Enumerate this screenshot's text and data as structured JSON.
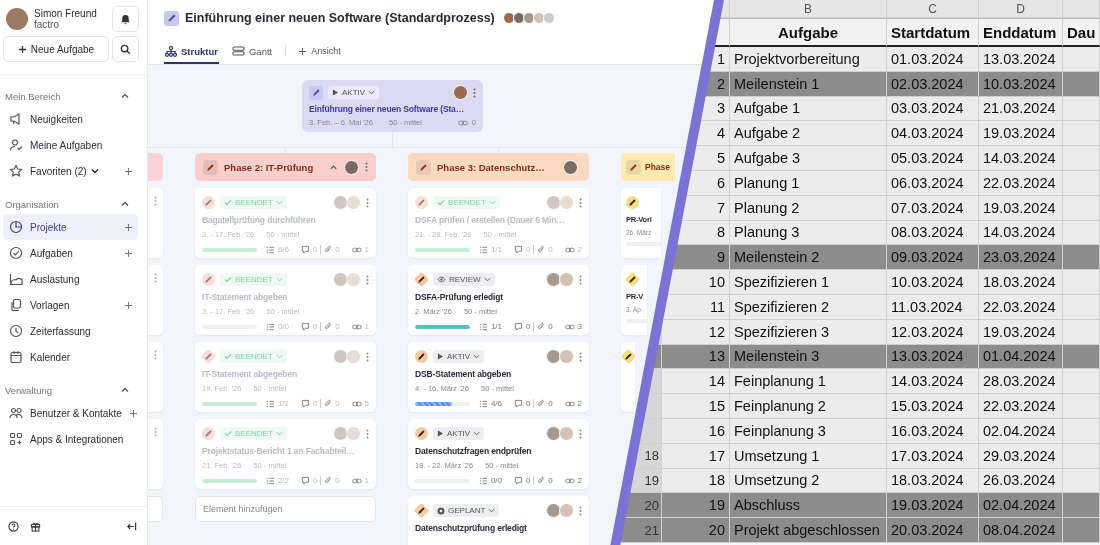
{
  "sidebar": {
    "user": {
      "name": "Simon Freund",
      "company": "factro"
    },
    "new_task_button": "Neue Aufgabe",
    "sections": [
      {
        "title": "Mein Bereich",
        "expanded": true,
        "items": [
          {
            "label": "Neuigkeiten",
            "selected": false,
            "addable": false,
            "submenu": false
          },
          {
            "label": "Meine Aufgaben",
            "selected": false,
            "addable": false,
            "submenu": false
          },
          {
            "label": "Favoriten (2)",
            "selected": false,
            "addable": true,
            "submenu": true
          }
        ]
      },
      {
        "title": "Organisation",
        "expanded": true,
        "items": [
          {
            "label": "Projekte",
            "selected": true,
            "addable": true,
            "submenu": false
          },
          {
            "label": "Aufgaben",
            "selected": false,
            "addable": true,
            "submenu": false
          },
          {
            "label": "Auslastung",
            "selected": false,
            "addable": false,
            "submenu": false
          },
          {
            "label": "Vorlagen",
            "selected": false,
            "addable": true,
            "submenu": false
          },
          {
            "label": "Zeiterfassung",
            "selected": false,
            "addable": false,
            "submenu": false
          },
          {
            "label": "Kalender",
            "selected": false,
            "addable": false,
            "submenu": false
          }
        ]
      },
      {
        "title": "Verwaltung",
        "expanded": true,
        "items": [
          {
            "label": "Benutzer & Kontakte",
            "selected": false,
            "addable": true,
            "submenu": false
          },
          {
            "label": "Apps & Integrationen",
            "selected": false,
            "addable": false,
            "submenu": false
          }
        ]
      }
    ]
  },
  "header": {
    "title": "Einführung einer neuen Software (Standardprozess)",
    "tabs": [
      {
        "label": "Struktur",
        "selected": true
      },
      {
        "label": "Gantt",
        "selected": false
      }
    ],
    "add_view": "Ansicht"
  },
  "project_node": {
    "status": {
      "kind": "active",
      "label": "AKTIV"
    },
    "title": "Einführung einer neuen Software (Sta…",
    "dates": "3. Feb. – 6. Mai '26",
    "priority": "50 - mittel",
    "links": "0"
  },
  "phases": [
    {
      "title": "Phase 2: IT-Prüfung",
      "color": "#f9cfcc",
      "add_placeholder": "Element hinzufügen",
      "cards": [
        {
          "kind": "task",
          "status": {
            "kind": "done",
            "label": "BEENDET"
          },
          "title": "Bagatellprüfung durchführen",
          "dates": "3. - 17. Feb. '26",
          "priority": "50 - mittel",
          "level": 1,
          "subtasks": "6/6",
          "comments": "0",
          "attachments": "0",
          "links": "1"
        },
        {
          "kind": "task",
          "status": {
            "kind": "done",
            "label": "BEENDET"
          },
          "title": "IT-Statement abgeben",
          "dates": "3. - 17. Feb. '26",
          "priority": "50 - mittel",
          "level": 0,
          "subtasks": "0/0",
          "comments": "0",
          "attachments": "0",
          "links": "1"
        },
        {
          "kind": "milestone",
          "status": {
            "kind": "done",
            "label": "BEENDET"
          },
          "title": "IT-Statement abgegeben",
          "dates": "19. Feb. '26",
          "priority": "50 - mittel",
          "level": 1,
          "subtasks": "1/1",
          "comments": "0",
          "attachments": "0",
          "links": "5"
        },
        {
          "kind": "task",
          "status": {
            "kind": "done",
            "label": "BEENDET"
          },
          "title": "Projektstatus-Bericht 1 an Fachabteil…",
          "dates": "21. Feb. '26",
          "priority": "50 - mittel",
          "level": 1,
          "subtasks": "2/2",
          "comments": "0",
          "attachments": "0",
          "links": "1"
        }
      ]
    },
    {
      "title": "Phase 3: Datenschutz…",
      "color": "#fcd9c0",
      "cards": [
        {
          "kind": "task",
          "status": {
            "kind": "done",
            "label": "BEENDET"
          },
          "title": "DSFA prüfen / erstellen (Dauer 5 Min…",
          "dates": "21. - 28. Feb. '26",
          "priority": "50 - mittel",
          "level": 1,
          "subtasks": "1/1",
          "comments": "0",
          "attachments": "0",
          "links": "2"
        },
        {
          "kind": "milestone",
          "status": {
            "kind": "review",
            "label": "REVIEW"
          },
          "title": "DSFA-Prüfung erledigt",
          "dates": "2. März '26",
          "priority": "50 - mittel",
          "level": 1,
          "subtasks": "1/1",
          "comments": "0",
          "attachments": "0",
          "links": "3"
        },
        {
          "kind": "task",
          "status": {
            "kind": "active",
            "label": "AKTIV"
          },
          "title": "DSB-Statement abgeben",
          "dates": "4. - 16. März '26",
          "priority": "50 - mittel",
          "level": 0.67,
          "subtasks": "4/6",
          "comments": "0",
          "attachments": "0",
          "links": "2"
        },
        {
          "kind": "task",
          "status": {
            "kind": "active",
            "label": "AKTIV"
          },
          "title": "Datenschutzfragen endprüfen",
          "dates": "18. - 22. März '26",
          "priority": "50 - mittel",
          "level": 0,
          "subtasks": "0/0",
          "comments": "0",
          "attachments": "0",
          "links": "2"
        },
        {
          "kind": "milestone",
          "status": {
            "kind": "planned",
            "label": "GEPLANT"
          },
          "title": "Datenschutzprüfung erledigt"
        }
      ]
    },
    {
      "title": "Phase",
      "color": "#fdeab0",
      "cards": [
        {
          "kind": "task",
          "title": "PR-Vorl",
          "dates": "26. März",
          "level": 0
        },
        {
          "kind": "milestone",
          "title": "PR-V",
          "dates": "3. Ap",
          "level": 0
        },
        {
          "kind": "milestone"
        }
      ]
    }
  ],
  "sheet": {
    "column_letters": [
      "B",
      "C",
      "D"
    ],
    "headers": [
      "Aufgabe",
      "Startdatum",
      "Enddatum",
      "Dau"
    ],
    "rows": [
      {
        "no": "1",
        "task": "Projektvorbereitung",
        "start": "01.03.2024",
        "end": "13.03.2024",
        "highlighted": false
      },
      {
        "no": "2",
        "task": "Meilenstein 1",
        "start": "02.03.2024",
        "end": "10.03.2024",
        "highlighted": true
      },
      {
        "no": "3",
        "task": "Aufgabe 1",
        "start": "03.03.2024",
        "end": "21.03.2024",
        "highlighted": false
      },
      {
        "no": "4",
        "task": "Aufgabe 2",
        "start": "04.03.2024",
        "end": "19.03.2024",
        "highlighted": false
      },
      {
        "no": "5",
        "task": "Aufgabe 3",
        "start": "05.03.2024",
        "end": "14.03.2024",
        "highlighted": false
      },
      {
        "no": "6",
        "task": "Planung 1",
        "start": "06.03.2024",
        "end": "22.03.2024",
        "highlighted": false
      },
      {
        "no": "7",
        "task": "Planung 2",
        "start": "07.03.2024",
        "end": "19.03.2024",
        "highlighted": false
      },
      {
        "no": "8",
        "task": "Planung 3",
        "start": "08.03.2024",
        "end": "14.03.2024",
        "highlighted": false
      },
      {
        "no": "9",
        "task": "Meilenstein 2",
        "start": "09.03.2024",
        "end": "23.03.2024",
        "highlighted": true
      },
      {
        "no": "10",
        "task": "Spezifizieren 1",
        "start": "10.03.2024",
        "end": "18.03.2024",
        "highlighted": false
      },
      {
        "no": "11",
        "task": "Spezifizieren 2",
        "start": "11.03.2024",
        "end": "22.03.2024",
        "highlighted": false
      },
      {
        "no": "12",
        "task": "Spezifizieren 3",
        "start": "12.03.2024",
        "end": "19.03.2024",
        "highlighted": false
      },
      {
        "no": "13",
        "task": "Meilenstein 3",
        "start": "13.03.2024",
        "end": "01.04.2024",
        "highlighted": true
      },
      {
        "no": "14",
        "task": "Feinplanung 1",
        "start": "14.03.2024",
        "end": "28.03.2024",
        "highlighted": false
      },
      {
        "no": "15",
        "task": "Feinplanung 2",
        "start": "15.03.2024",
        "end": "22.03.2024",
        "highlighted": false
      },
      {
        "no": "16",
        "task": "Feinplanung 3",
        "start": "16.03.2024",
        "end": "02.04.2024",
        "highlighted": false
      },
      {
        "row_header": "18",
        "no": "17",
        "task": "Umsetzung 1",
        "start": "17.03.2024",
        "end": "29.03.2024",
        "highlighted": false
      },
      {
        "row_header": "19",
        "no": "18",
        "task": "Umsetzung 2",
        "start": "18.03.2024",
        "end": "26.03.2024",
        "highlighted": false
      },
      {
        "row_header": "20",
        "no": "19",
        "task": "Abschluss",
        "start": "19.03.2024",
        "end": "02.04.2024",
        "highlighted": true
      },
      {
        "row_header": "21",
        "no": "20",
        "task": "Projekt abgeschlossen",
        "start": "20.03.2024",
        "end": "08.04.2024",
        "highlighted": true
      }
    ]
  }
}
